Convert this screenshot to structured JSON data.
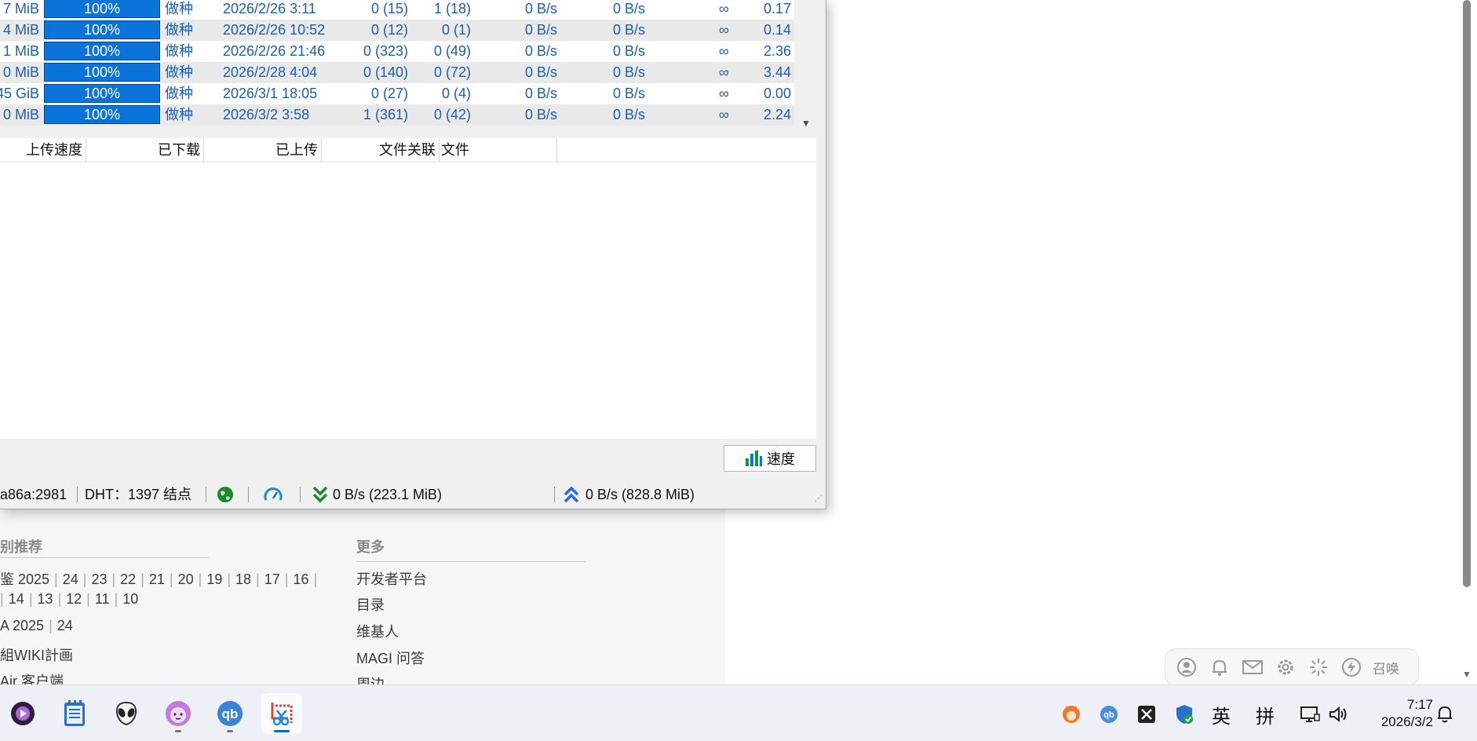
{
  "torrents": {
    "rows": [
      {
        "size": "7 MiB",
        "progress": "100%",
        "progress_value": 100,
        "status": "做种",
        "added": "2026/2/26 3:11",
        "seeds": "0 (15)",
        "peers": "1 (18)",
        "down_speed": "0 B/s",
        "up_speed": "0 B/s",
        "eta": "∞",
        "ratio": "0.17"
      },
      {
        "size": "4 MiB",
        "progress": "100%",
        "progress_value": 100,
        "status": "做种",
        "added": "2026/2/26 10:52",
        "seeds": "0 (12)",
        "peers": "0 (1)",
        "down_speed": "0 B/s",
        "up_speed": "0 B/s",
        "eta": "∞",
        "ratio": "0.14"
      },
      {
        "size": "1 MiB",
        "progress": "100%",
        "progress_value": 100,
        "status": "做种",
        "added": "2026/2/26 21:46",
        "seeds": "0 (323)",
        "peers": "0 (49)",
        "down_speed": "0 B/s",
        "up_speed": "0 B/s",
        "eta": "∞",
        "ratio": "2.36"
      },
      {
        "size": "0 MiB",
        "progress": "100%",
        "progress_value": 100,
        "status": "做种",
        "added": "2026/2/28 4:04",
        "seeds": "0 (140)",
        "peers": "0 (72)",
        "down_speed": "0 B/s",
        "up_speed": "0 B/s",
        "eta": "∞",
        "ratio": "3.44"
      },
      {
        "size": "45 GiB",
        "progress": "100%",
        "progress_value": 100,
        "status": "做种",
        "added": "2026/3/1 18:05",
        "seeds": "0 (27)",
        "peers": "0 (4)",
        "down_speed": "0 B/s",
        "up_speed": "0 B/s",
        "eta": "∞",
        "ratio": "0.00"
      },
      {
        "size": "0 MiB",
        "progress": "100%",
        "progress_value": 100,
        "status": "做种",
        "added": "2026/3/2 3:58",
        "seeds": "1 (361)",
        "peers": "0 (42)",
        "down_speed": "0 B/s",
        "up_speed": "0 B/s",
        "eta": "∞",
        "ratio": "2.24"
      }
    ]
  },
  "peers_header": {
    "upload_speed": "上传速度",
    "downloaded": "已下载",
    "uploaded": "已上传",
    "file_relevance": "文件关联",
    "files": "文件"
  },
  "speed_button": {
    "label": "速度"
  },
  "statusbar": {
    "address": "a86a:2981",
    "dht": "DHT：1397 结点",
    "download": "0 B/s (223.1 MiB)",
    "upload": "0 B/s (828.8 MiB)"
  },
  "webpage": {
    "left_heading": "别推荐",
    "right_heading": "更多",
    "line1": [
      "鉴 2025",
      "24",
      "23",
      "22",
      "21",
      "20",
      "19",
      "18",
      "17",
      "16"
    ],
    "line2": [
      "14",
      "13",
      "12",
      "11",
      "10"
    ],
    "line3": [
      "A 2025",
      "24"
    ],
    "line4": "組WIKI計画",
    "line5": "Air 客户端",
    "more_links": [
      "开发者平台",
      "目录",
      "维基人",
      "MAGI 问答",
      "周边"
    ]
  },
  "float_bar": {
    "icons": [
      "user-icon",
      "bell-icon",
      "mail-icon",
      "gear-icon",
      "sparkle-icon",
      "lightning-icon"
    ],
    "summon_label": "召唤"
  },
  "taskbar": {
    "apps": [
      "media-player",
      "notepad",
      "alien-app",
      "cat-app",
      "qbittorrent",
      "snipping-tool"
    ],
    "ime_lang": "英",
    "ime_mode": "拼",
    "time": "7:17",
    "date": "2026/3/2"
  },
  "colors": {
    "accent": "#0a74da",
    "text_blue": "#1a5fb4",
    "taskbar": "#eef0f5"
  }
}
